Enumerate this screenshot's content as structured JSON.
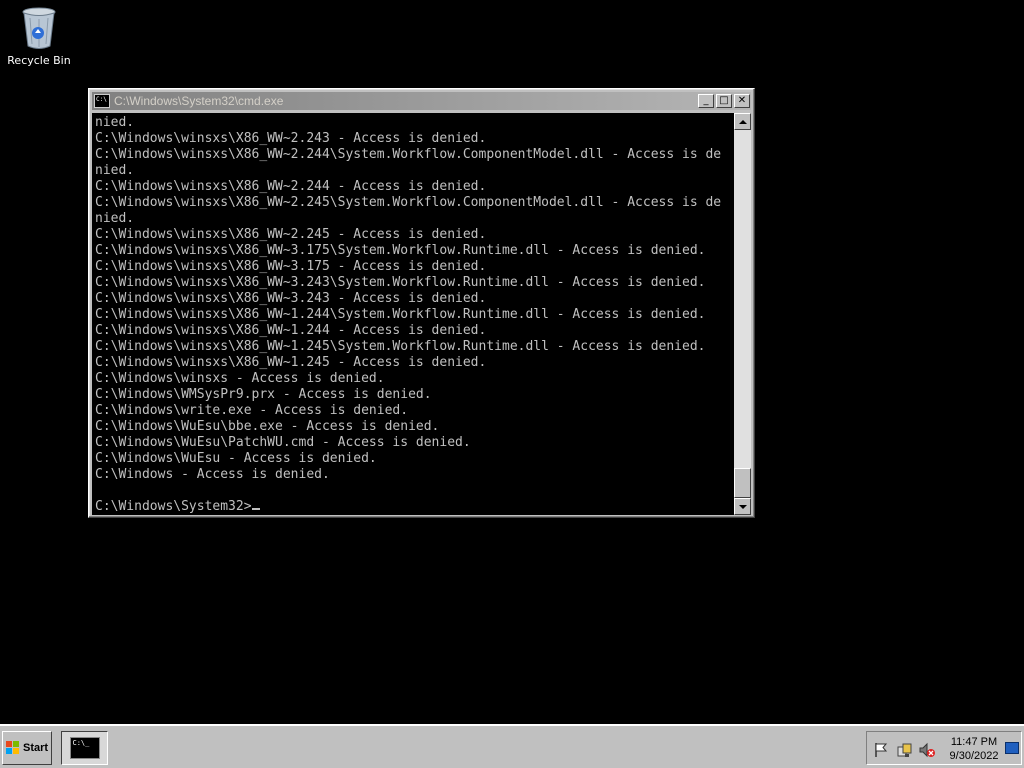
{
  "desktop": {
    "recycle_bin_label": "Recycle Bin"
  },
  "window": {
    "title": "C:\\Windows\\System32\\cmd.exe",
    "minimize": "_",
    "maximize": "□",
    "close": "✕",
    "console_lines": [
      "nied.",
      "C:\\Windows\\winsxs\\X86_WW~2.243 - Access is denied.",
      "C:\\Windows\\winsxs\\X86_WW~2.244\\System.Workflow.ComponentModel.dll - Access is de",
      "nied.",
      "C:\\Windows\\winsxs\\X86_WW~2.244 - Access is denied.",
      "C:\\Windows\\winsxs\\X86_WW~2.245\\System.Workflow.ComponentModel.dll - Access is de",
      "nied.",
      "C:\\Windows\\winsxs\\X86_WW~2.245 - Access is denied.",
      "C:\\Windows\\winsxs\\X86_WW~3.175\\System.Workflow.Runtime.dll - Access is denied.",
      "C:\\Windows\\winsxs\\X86_WW~3.175 - Access is denied.",
      "C:\\Windows\\winsxs\\X86_WW~3.243\\System.Workflow.Runtime.dll - Access is denied.",
      "C:\\Windows\\winsxs\\X86_WW~3.243 - Access is denied.",
      "C:\\Windows\\winsxs\\X86_WW~1.244\\System.Workflow.Runtime.dll - Access is denied.",
      "C:\\Windows\\winsxs\\X86_WW~1.244 - Access is denied.",
      "C:\\Windows\\winsxs\\X86_WW~1.245\\System.Workflow.Runtime.dll - Access is denied.",
      "C:\\Windows\\winsxs\\X86_WW~1.245 - Access is denied.",
      "C:\\Windows\\winsxs - Access is denied.",
      "C:\\Windows\\WMSysPr9.prx - Access is denied.",
      "C:\\Windows\\write.exe - Access is denied.",
      "C:\\Windows\\WuEsu\\bbe.exe - Access is denied.",
      "C:\\Windows\\WuEsu\\PatchWU.cmd - Access is denied.",
      "C:\\Windows\\WuEsu - Access is denied.",
      "C:\\Windows - Access is denied.",
      ""
    ],
    "prompt": "C:\\Windows\\System32>"
  },
  "taskbar": {
    "start_label": "Start",
    "clock_time": "11:47 PM",
    "clock_date": "9/30/2022",
    "cmd_icon_text": "C:\\_"
  },
  "colors": {
    "console_text": "#c0c0c0",
    "console_bg": "#000000",
    "title_inactive": "#808080",
    "chrome": "#c0c0c0"
  }
}
